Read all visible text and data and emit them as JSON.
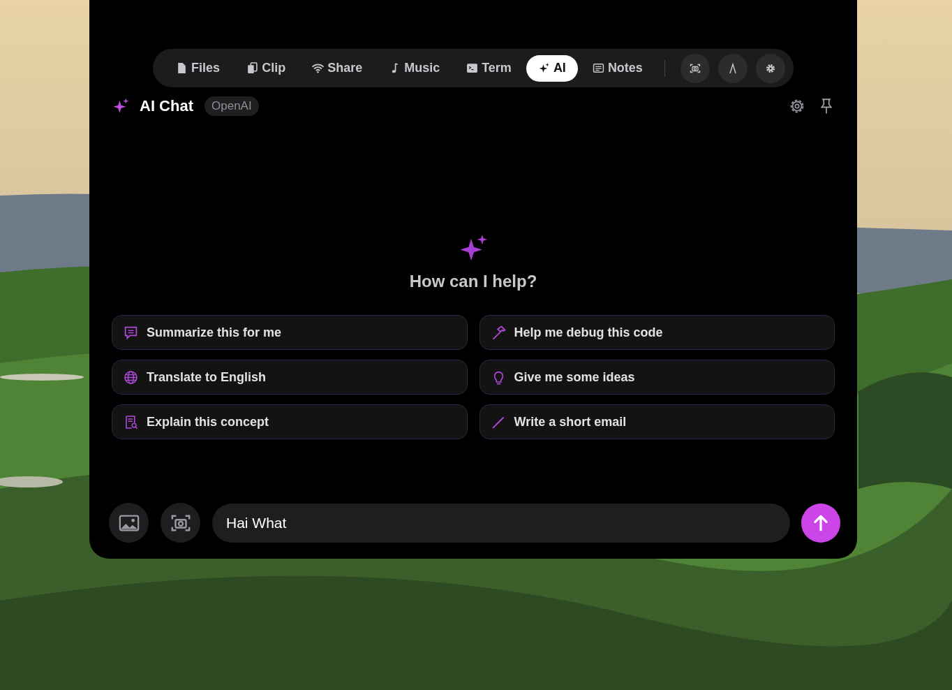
{
  "tabs": [
    {
      "label": "Files",
      "kind": "file",
      "selected": false
    },
    {
      "label": "Clip",
      "kind": "clip",
      "selected": false
    },
    {
      "label": "Share",
      "kind": "wifi",
      "selected": false
    },
    {
      "label": "Music",
      "kind": "note",
      "selected": false
    },
    {
      "label": "Term",
      "kind": "terminal",
      "selected": false
    },
    {
      "label": "AI",
      "kind": "sparkle",
      "selected": true
    },
    {
      "label": "Notes",
      "kind": "notes",
      "selected": false
    }
  ],
  "tools": [
    {
      "kind": "camera"
    },
    {
      "kind": "compass"
    },
    {
      "kind": "gear"
    }
  ],
  "header": {
    "title": "AI Chat",
    "provider": "OpenAI"
  },
  "hero": {
    "prompt": "How can I help?"
  },
  "suggestions": [
    {
      "label": "Summarize this for me",
      "kind": "chat"
    },
    {
      "label": "Help me debug this code",
      "kind": "hammer"
    },
    {
      "label": "Translate to English",
      "kind": "globe"
    },
    {
      "label": "Give me some ideas",
      "kind": "bulb"
    },
    {
      "label": "Explain this concept",
      "kind": "doc"
    },
    {
      "label": "Write a short email",
      "kind": "pen"
    }
  ],
  "composer": {
    "value": "Hai What"
  }
}
